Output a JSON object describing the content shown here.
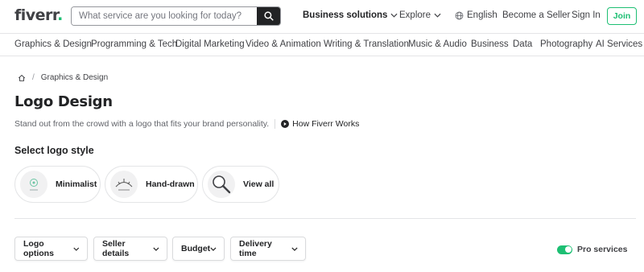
{
  "header": {
    "logo_text": "fiverr",
    "logo_dot": ".",
    "search_placeholder": "What service are you looking for today?",
    "nav": {
      "business_solutions": "Business solutions",
      "explore": "Explore",
      "language": "English",
      "become_seller": "Become a Seller",
      "sign_in": "Sign In",
      "join": "Join"
    }
  },
  "categories": [
    "Graphics & Design",
    "Programming & Tech",
    "Digital Marketing",
    "Video & Animation",
    "Writing & Translation",
    "Music & Audio",
    "Business",
    "Data",
    "Photography",
    "AI Services"
  ],
  "breadcrumb": {
    "current": "Graphics & Design",
    "separator": "/"
  },
  "page": {
    "title": "Logo Design",
    "subtitle": "Stand out from the crowd with a logo that fits your brand personality.",
    "how_works": "How Fiverr Works"
  },
  "logo_style": {
    "heading": "Select logo style",
    "options": [
      "Minimalist",
      "Hand-drawn",
      "View all"
    ]
  },
  "filters": {
    "logo_options": "Logo options",
    "seller_details": "Seller details",
    "budget": "Budget",
    "delivery_time": "Delivery time",
    "pro_services": "Pro services",
    "pro_services_on": true
  },
  "colors": {
    "brand_green": "#1dbf73",
    "text_dark": "#222325"
  }
}
